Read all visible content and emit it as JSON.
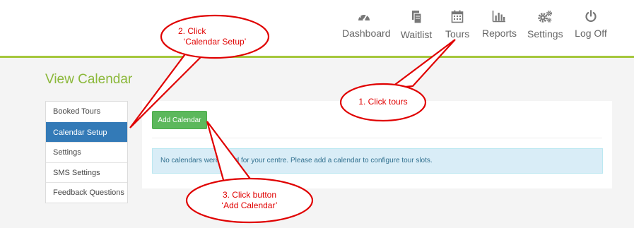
{
  "nav": {
    "items": [
      {
        "label": "Dashboard",
        "icon": "dashboard-icon"
      },
      {
        "label": "Waitlist",
        "icon": "document-icon"
      },
      {
        "label": "Tours",
        "icon": "calendar-icon"
      },
      {
        "label": "Reports",
        "icon": "bar-chart-icon"
      },
      {
        "label": "Settings",
        "icon": "gears-icon"
      },
      {
        "label": "Log Off",
        "icon": "power-icon"
      }
    ]
  },
  "page": {
    "title": "View Calendar"
  },
  "sidebar": {
    "items": [
      {
        "label": "Booked Tours"
      },
      {
        "label": "Calendar Setup",
        "active": true
      },
      {
        "label": "Settings"
      },
      {
        "label": "SMS Settings"
      },
      {
        "label": "Feedback Questions"
      }
    ]
  },
  "main": {
    "add_button": "Add Calendar",
    "alert": "No calendars were found for your centre. Please add a calendar to configure tour slots."
  },
  "callouts": {
    "step1": "1. Click tours",
    "step2_line1": "2. Click",
    "step2_line2": "‘Calendar Setup’",
    "step3_line1": "3. Click button",
    "step3_line2": "‘Add Calendar’"
  },
  "colors": {
    "accent_green": "#8bb83a",
    "active_blue": "#337ab7",
    "button_green": "#5cb85c",
    "alert_bg": "#d9edf7",
    "callout_red": "#e00000"
  }
}
